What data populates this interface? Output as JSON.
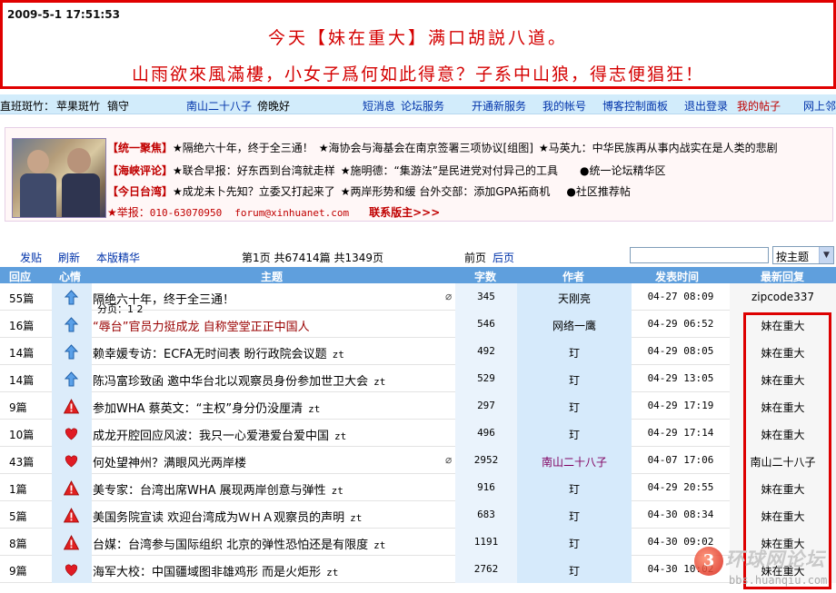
{
  "banner": {
    "datetime": "2009-5-1 17:51:53",
    "line1": "今天【妹在重大】满口胡説八道。",
    "line2": "山雨欲來風滿樓，小女子爲何如此得意？子系中山狼，得志便猖狂！"
  },
  "navbar": {
    "left_prefix": "直班斑竹：",
    "mod1": "苹果斑竹",
    "mod2": "镝守",
    "user": "南山二十八子",
    "greeting": "傍晚好",
    "messages": "短消息",
    "forum_service": "论坛服务",
    "new_service": "开通新服务",
    "my_account": "我的帐号",
    "blog_panel": "博客控制面板",
    "logout": "退出登录",
    "my_posts": "我的帖子",
    "net_neighbor": "网上邻"
  },
  "promo": {
    "row1": [
      {
        "tag": "【统一聚焦】"
      },
      {
        "text": "★隔绝六十年，终于全三通！"
      },
      {
        "text": "★海协会与海基会在南京签署三项协议[组图]"
      },
      {
        "text": "★马英九：中华民族再从事内战实在是人类的悲剧"
      }
    ],
    "row2": [
      {
        "tag": "【海峡评论】"
      },
      {
        "text": "★联合早报：好东西到台湾就走样"
      },
      {
        "text": "★施明德：“集游法”是民进党对付异己的工具"
      },
      {
        "text": "●统一论坛精华区"
      }
    ],
    "row3": [
      {
        "tag": "【今日台湾】"
      },
      {
        "text": "★成龙未卜先知？立委又打起来了"
      },
      {
        "text": "★两岸形势和缓 台外交部：添加GPA拓商机"
      },
      {
        "text": "●社区推荐帖"
      }
    ],
    "report_label": "★举报：",
    "phone": "010-63070950",
    "email": "forum@xinhuanet.com",
    "contact": "联系版主>>>"
  },
  "toolbar": {
    "post": "发贴",
    "refresh": "刷新",
    "digest": "本版精华",
    "page_info": "第1页 共67414篇 共1349页",
    "prev": "前页",
    "next": "后页",
    "search_placeholder": "",
    "sort_value": "按主题"
  },
  "table": {
    "headers": {
      "reply": "回应",
      "mood": "心情",
      "subject": "主题",
      "chars": "字数",
      "author": "作者",
      "time": "发表时间",
      "last_reply": "最新回复"
    },
    "rows": [
      {
        "reply": "55篇",
        "mood": "up-arrow-icon",
        "title": "隔绝六十年，终于全三通！",
        "zt": "",
        "pages": "分页：1 2",
        "clip": true,
        "chars": "345",
        "author": "天刚亮",
        "time": "04-27 08:09",
        "last": "zipcode337"
      },
      {
        "reply": "16篇",
        "mood": "up-arrow-icon",
        "title": "“辱台”官员力挺成龙 自称堂堂正正中国人",
        "zt": "",
        "pages": "",
        "clip": false,
        "chars": "546",
        "author": "网络一鹰",
        "time": "04-29 06:52",
        "last": "妹在重大"
      },
      {
        "reply": "14篇",
        "mood": "up-arrow-icon",
        "title": "赖幸媛专访：ECFA无时间表 盼行政院会议题",
        "zt": "zt",
        "pages": "",
        "clip": false,
        "chars": "492",
        "author": "玎",
        "time": "04-29 08:05",
        "last": "妹在重大"
      },
      {
        "reply": "14篇",
        "mood": "up-arrow-icon",
        "title": "陈冯富珍致函 邀中华台北以观察员身份参加世卫大会",
        "zt": "zt",
        "pages": "",
        "clip": false,
        "chars": "529",
        "author": "玎",
        "time": "04-29 13:05",
        "last": "妹在重大"
      },
      {
        "reply": "9篇",
        "mood": "warning-icon",
        "title": "参加WHA  蔡英文：“主权”身分仍没厘清",
        "zt": "zt",
        "pages": "",
        "clip": false,
        "chars": "297",
        "author": "玎",
        "time": "04-29 17:19",
        "last": "妹在重大"
      },
      {
        "reply": "10篇",
        "mood": "heart-icon",
        "title": "成龙开腔回应风波：我只一心爱港爱台爱中国",
        "zt": "zt",
        "pages": "",
        "clip": false,
        "chars": "496",
        "author": "玎",
        "time": "04-29 17:14",
        "last": "妹在重大"
      },
      {
        "reply": "43篇",
        "mood": "heart-icon",
        "title": "何处望神州？满眼风光两岸楼",
        "zt": "",
        "pages": "",
        "clip": true,
        "chars": "2952",
        "author": "南山二十八子",
        "time": "04-07 17:06",
        "last": "南山二十八子"
      },
      {
        "reply": "1篇",
        "mood": "warning-icon",
        "title": "美专家：台湾出席WHA 展现两岸创意与弹性",
        "zt": "zt",
        "pages": "",
        "clip": false,
        "chars": "916",
        "author": "玎",
        "time": "04-29 20:55",
        "last": "妹在重大"
      },
      {
        "reply": "5篇",
        "mood": "warning-icon",
        "title": "美国务院宣读 欢迎台湾成为ＷＨＡ观察员的声明",
        "zt": "zt",
        "pages": "",
        "clip": false,
        "chars": "683",
        "author": "玎",
        "time": "04-30 08:34",
        "last": "妹在重大"
      },
      {
        "reply": "8篇",
        "mood": "warning-icon",
        "title": "台媒：台湾参与国际组织 北京的弹性恐怕还是有限度",
        "zt": "zt",
        "pages": "",
        "clip": false,
        "chars": "1191",
        "author": "玎",
        "time": "04-30 09:02",
        "last": "妹在重大"
      },
      {
        "reply": "9篇",
        "mood": "heart-icon",
        "title": "海军大校：中国疆域图非雄鸡形 而是火炬形",
        "zt": "zt",
        "pages": "",
        "clip": false,
        "chars": "2762",
        "author": "玎",
        "time": "04-30 10:02",
        "last": "妹在重大"
      }
    ]
  },
  "watermark": {
    "number": "3",
    "brand": "环球网论坛",
    "url": "bbs.huanqiu.com"
  },
  "colors": {
    "banner_border": "#e00000",
    "banner_text": "#d40000",
    "header_bar": "#5f9fdd",
    "link": "#0033aa",
    "highlight": "#dd0000"
  }
}
